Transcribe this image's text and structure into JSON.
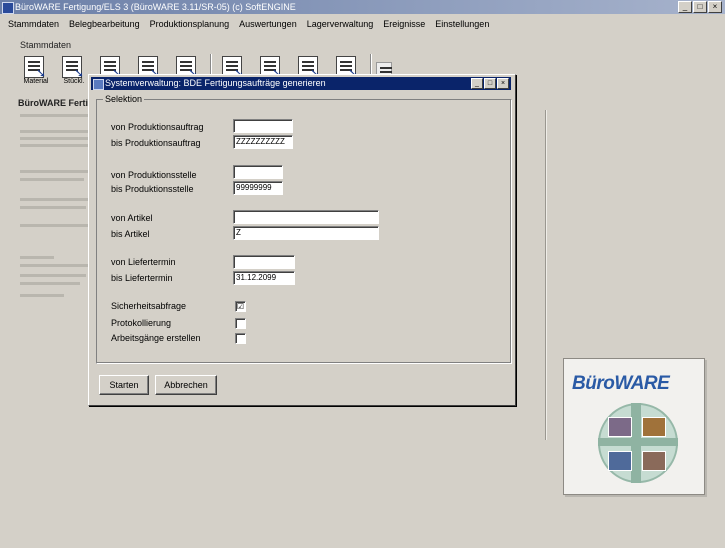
{
  "window": {
    "title": "BüroWARE Fertigung/ELS 3 (BüroWARE 3.11/SR-05) (c) SoftENGINE",
    "controls": [
      "_",
      "□",
      "×"
    ]
  },
  "menu": [
    "Stammdaten",
    "Belegbearbeitung",
    "Produktionsplanung",
    "Auswertungen",
    "Lagerverwaltung",
    "Ereignisse",
    "Einstellungen"
  ],
  "section_label": "Stammdaten",
  "toolbar": {
    "captions": [
      "Material",
      "Stückl.",
      "",
      "",
      "",
      "",
      "",
      "",
      "",
      ""
    ]
  },
  "left_pane": {
    "heading": "BüroWARE Fertigung"
  },
  "dialog": {
    "title": "Systemverwaltung: BDE Fertigungsaufträge generieren",
    "group_label": "Selektion",
    "fields": {
      "von_prodauftrag": {
        "label": "von Produktionsauftrag",
        "value": ""
      },
      "bis_prodauftrag": {
        "label": "bis Produktionsauftrag",
        "value": "ZZZZZZZZZZ"
      },
      "von_prodstelle": {
        "label": "von Produktionsstelle",
        "value": ""
      },
      "bis_prodstelle": {
        "label": "bis Produktionsstelle",
        "value": "99999999"
      },
      "von_artikel": {
        "label": "von Artikel",
        "value": ""
      },
      "bis_artikel": {
        "label": "bis Artikel",
        "value": "Z"
      },
      "von_liefertermin": {
        "label": "von Liefertermin",
        "value": ""
      },
      "bis_liefertermin": {
        "label": "bis Liefertermin",
        "value": "31.12.2099"
      }
    },
    "checkboxes": {
      "sicherheitsabfrage": {
        "label": "Sicherheitsabfrage",
        "checked": "☑"
      },
      "protokoll": {
        "label": "Protokollierung",
        "checked": ""
      },
      "arbeitsgaenge": {
        "label": "Arbeitsgänge erstellen",
        "checked": ""
      }
    },
    "buttons": {
      "ok": "Starten",
      "cancel": "Abbrechen"
    }
  },
  "logo": {
    "text": "BüroWARE"
  },
  "colors": {
    "title_active": "#0a246a",
    "title_inactive": "#6b7fa8",
    "logo_blue": "#2a5aa5"
  }
}
